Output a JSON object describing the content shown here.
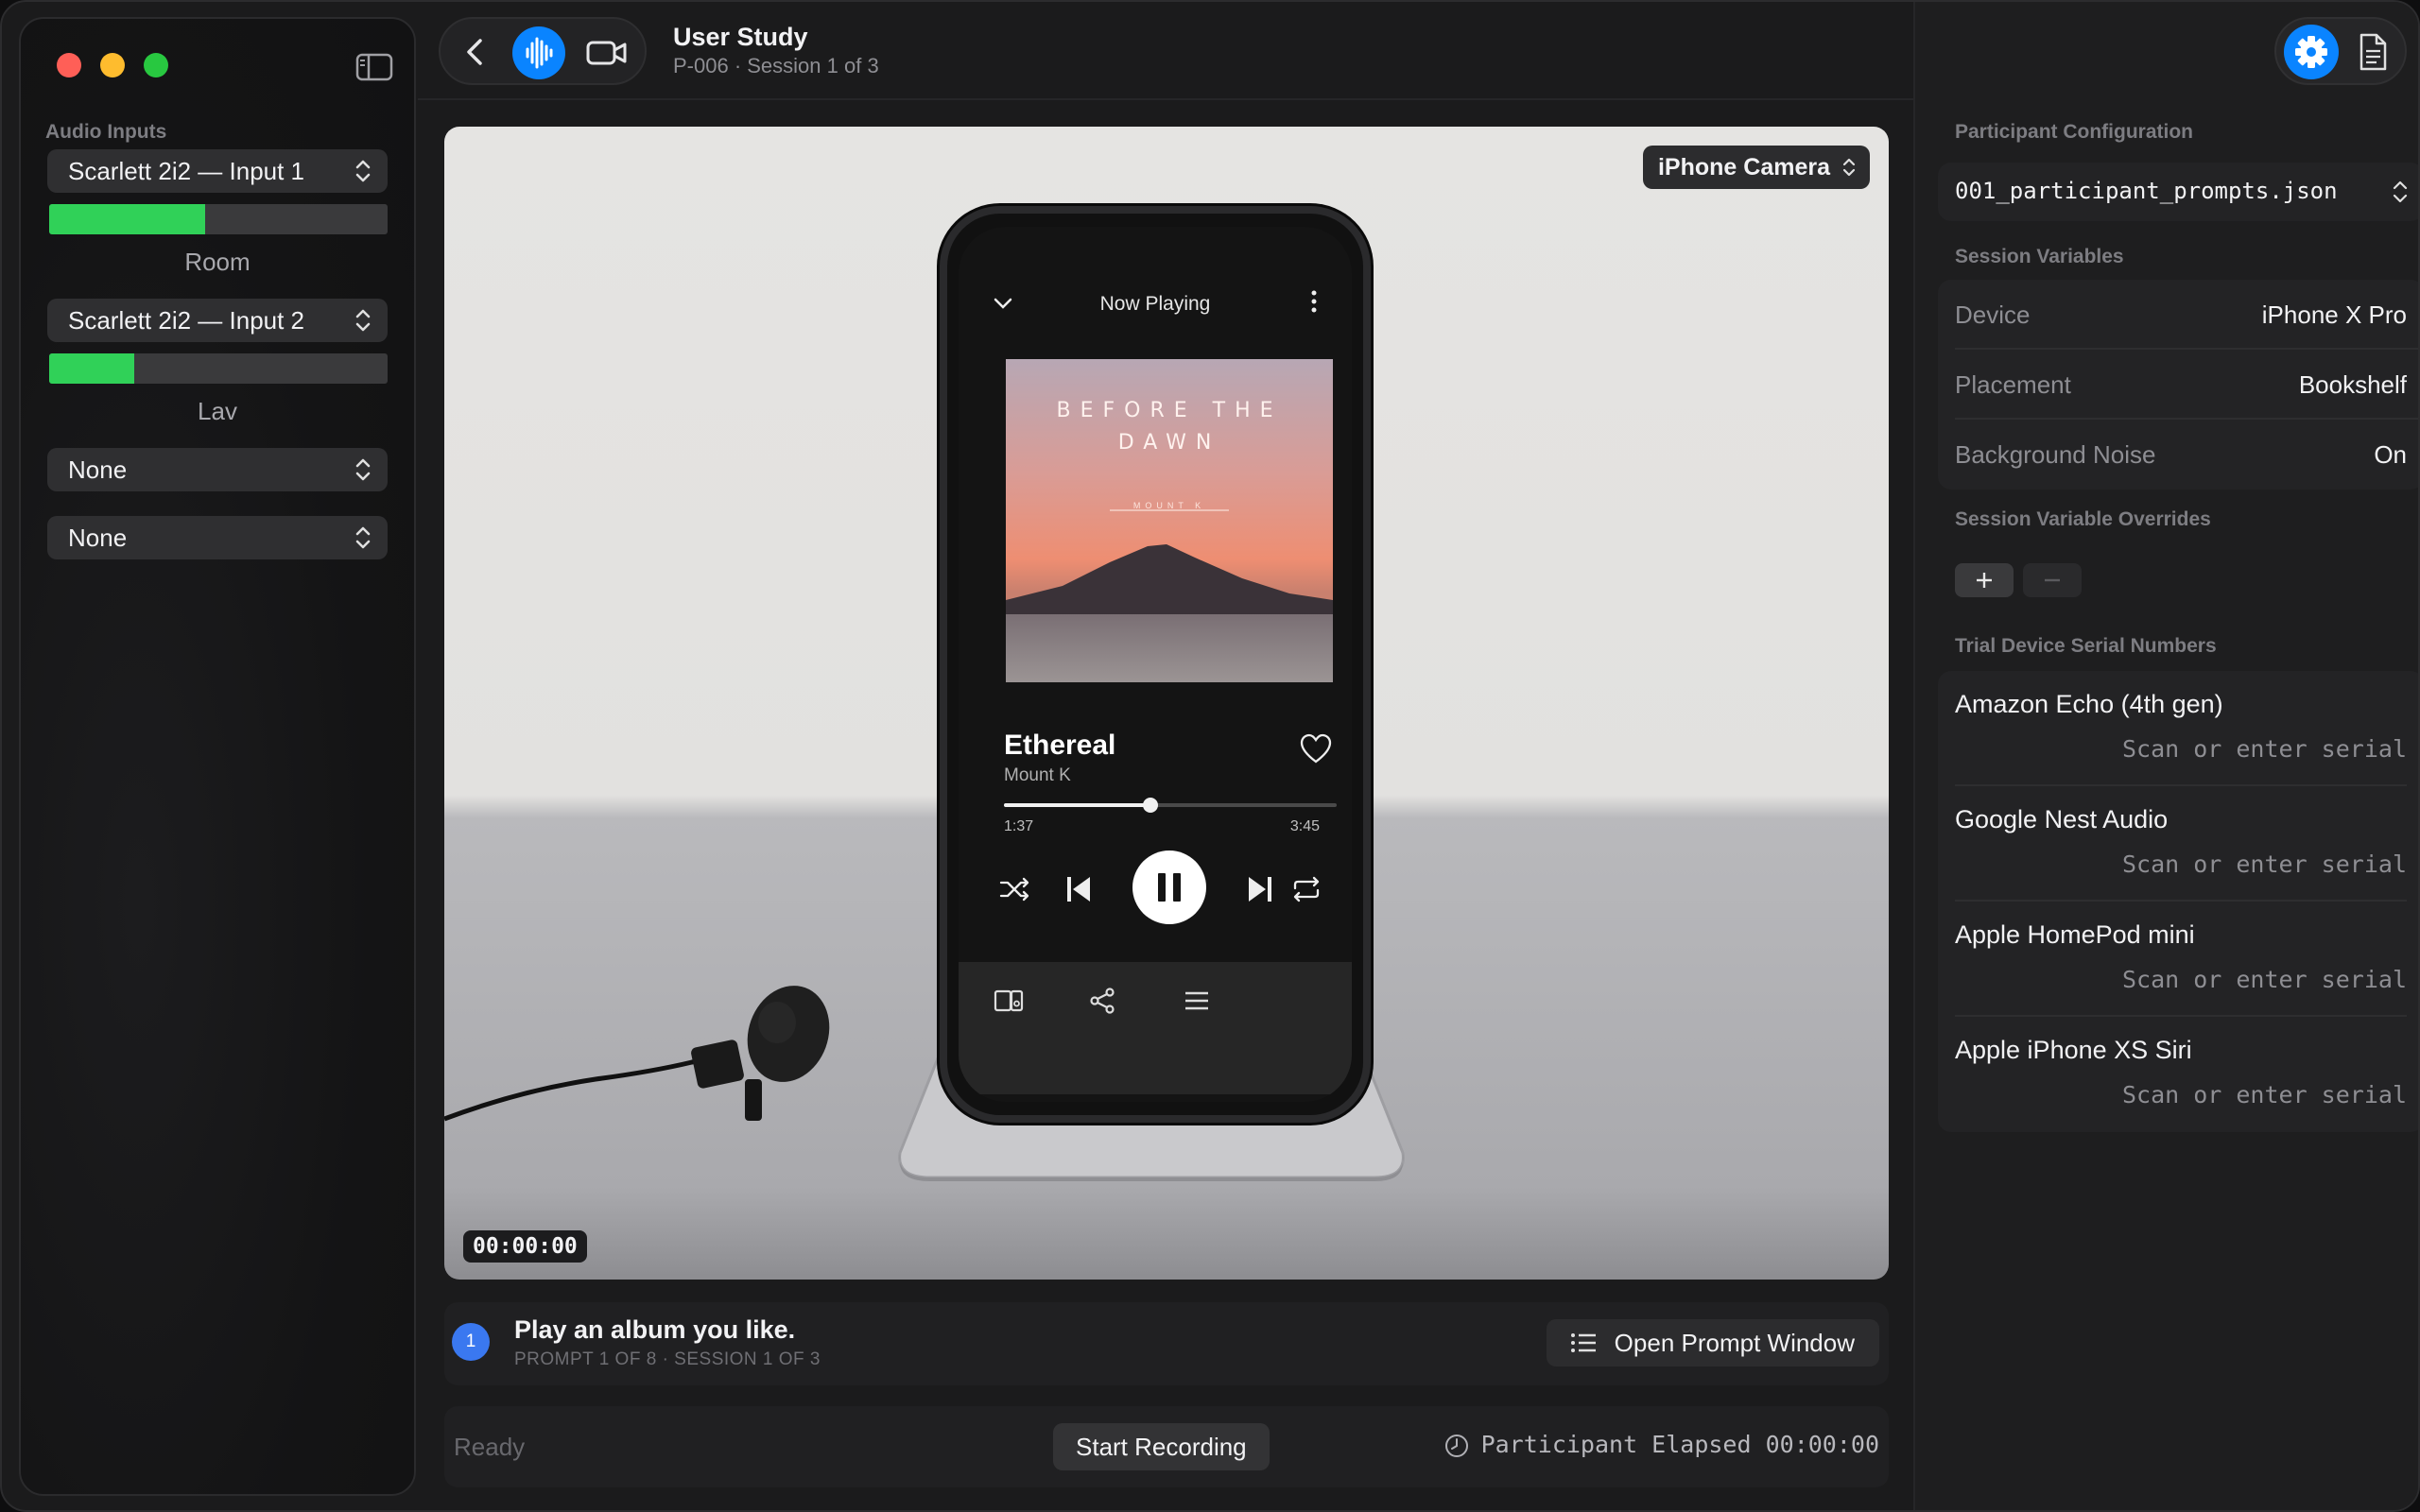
{
  "window": {
    "title": "User Study",
    "subtitle": "P-006 · Session 1 of 3"
  },
  "sidebar": {
    "section_label": "Audio Inputs",
    "inputs": [
      {
        "device": "Scarlett 2i2 — Input 1",
        "level": 0.46,
        "caption": "Room"
      },
      {
        "device": "Scarlett 2i2 — Input 2",
        "level": 0.25,
        "caption": "Lav"
      },
      {
        "device": "None"
      },
      {
        "device": "None"
      }
    ]
  },
  "toolbar": {
    "active_mode": "audio",
    "buttons": [
      "back-icon",
      "waveform-icon",
      "video-camera-icon"
    ]
  },
  "video": {
    "camera_source": "iPhone Camera",
    "timecode": "00:00:00",
    "phone_screen": {
      "header": "Now Playing",
      "album_title": "BEFORE THE DAWN",
      "album_artist": "MOUNT K",
      "song": "Ethereal",
      "artist": "Mount K",
      "elapsed": "1:37",
      "duration": "3:45",
      "progress": 0.44
    }
  },
  "prompt": {
    "number": "1",
    "text": "Play an album you like.",
    "meta": "PROMPT 1 OF 8 · SESSION 1 OF 3",
    "open_button": "Open Prompt Window"
  },
  "status": {
    "state": "Ready",
    "record_button": "Start Recording",
    "elapsed": "Participant Elapsed 00:00:00"
  },
  "right_panel": {
    "participant_config_label": "Participant Configuration",
    "participant_config_file": "001_participant_prompts.json",
    "session_variables_label": "Session Variables",
    "session_variables": [
      {
        "key": "Device",
        "value": "iPhone X Pro"
      },
      {
        "key": "Placement",
        "value": "Bookshelf"
      },
      {
        "key": "Background Noise",
        "value": "On"
      }
    ],
    "overrides_label": "Session Variable Overrides",
    "serials_label": "Trial Device Serial Numbers",
    "serial_placeholder": "Scan or enter serial",
    "devices": [
      {
        "name": "Amazon Echo (4th gen)"
      },
      {
        "name": "Google Nest Audio"
      },
      {
        "name": "Apple HomePod mini"
      },
      {
        "name": "Apple iPhone XS Siri"
      }
    ]
  },
  "colors": {
    "accent": "#0a84ff",
    "meter": "#30d158",
    "prompt_badge": "#3a78f0"
  }
}
